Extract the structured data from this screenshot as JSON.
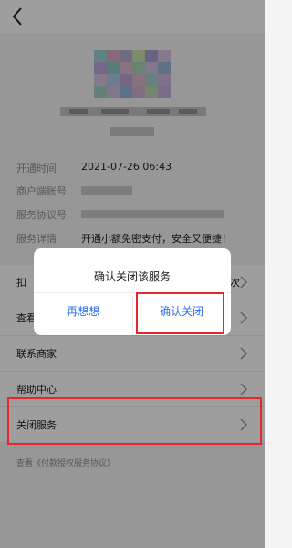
{
  "info": {
    "open_time_label": "开通时间",
    "open_time_value": "2021-07-26 06:43",
    "merchant_account_label": "商户端账号",
    "agreement_no_label": "服务协议号",
    "service_details_label": "服务详情",
    "service_details_value": "开通小额免密支付，安全又便捷！"
  },
  "menu": {
    "item1_prefix": "扣",
    "item1_suffix": "次",
    "item2_prefix": "查看",
    "contact_merchant": "联系商家",
    "help_center": "帮助中心",
    "close_service": "关闭服务"
  },
  "footer": {
    "agreement_link": "查看《付款授权服务协议》"
  },
  "dialog": {
    "title": "确认关闭该服务",
    "cancel": "再想想",
    "confirm": "确认关闭"
  },
  "colors": {
    "accent_blue": "#2b6ef0",
    "highlight_red": "#e5262b"
  },
  "icons": {
    "back": "back-arrow-icon",
    "chevron": "chevron-right-icon"
  }
}
